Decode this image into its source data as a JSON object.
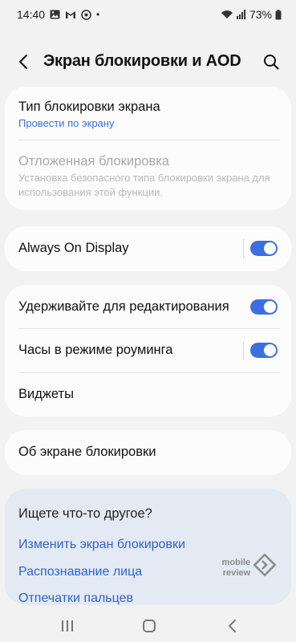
{
  "status_bar": {
    "time": "14:40",
    "dot": "•",
    "battery": "73%",
    "icons": [
      "gallery-icon",
      "gmail-icon",
      "messenger-icon",
      "wifi-icon",
      "signal-icon",
      "battery-icon"
    ]
  },
  "header": {
    "title": "Экран блокировки и AOD",
    "back_icon": "back-arrow-icon",
    "search_icon": "search-icon"
  },
  "card1": {
    "lock_type": {
      "title": "Тип блокировки экрана",
      "value": "Провести по экрану"
    },
    "delayed_lock": {
      "title": "Отложенная блокировка",
      "description": "Установка безопасного типа блокировки экрана для использования этой функции."
    }
  },
  "card2": {
    "aod": {
      "title": "Always On Display",
      "enabled": true
    }
  },
  "card3": {
    "hold_edit": {
      "title": "Удерживайте для редактирования",
      "enabled": true
    },
    "roaming_clock": {
      "title": "Часы в режиме роуминга",
      "enabled": true
    },
    "widgets": {
      "title": "Виджеты"
    }
  },
  "card4": {
    "about": {
      "title": "Об экране блокировки"
    }
  },
  "suggestions": {
    "title": "Ищете что-то другое?",
    "links": [
      "Изменить экран блокировки",
      "Распознавание лица",
      "Отпечатки пальцев"
    ]
  },
  "watermark": {
    "line1": "mobile",
    "line2": "review"
  },
  "colors": {
    "accent": "#3e6fe0",
    "link": "#2f63c8",
    "background": "#f2f2f2",
    "card": "#fcfcfc",
    "suggest_bg": "#e4eaf4"
  },
  "navbar": {
    "icons": [
      "recents-icon",
      "home-icon",
      "back-icon"
    ]
  }
}
